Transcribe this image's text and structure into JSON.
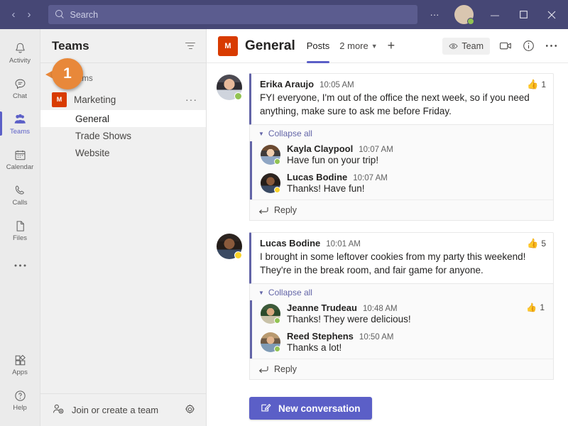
{
  "titlebar": {
    "back_label": "‹",
    "forward_label": "›",
    "search_placeholder": "Search",
    "more_label": "···",
    "minimize_label": "—",
    "maximize_label": "▫",
    "close_label": "✕",
    "user_presence": "available"
  },
  "rail": {
    "items": [
      {
        "label": "Activity",
        "icon": "bell-icon",
        "active": false
      },
      {
        "label": "Chat",
        "icon": "chat-icon",
        "active": false
      },
      {
        "label": "Teams",
        "icon": "teams-icon",
        "active": true
      },
      {
        "label": "Calendar",
        "icon": "calendar-icon",
        "active": false
      },
      {
        "label": "Calls",
        "icon": "phone-icon",
        "active": false
      },
      {
        "label": "Files",
        "icon": "file-icon",
        "active": false
      },
      {
        "label": "",
        "icon": "ellipsis-icon",
        "active": false
      }
    ],
    "bottom_items": [
      {
        "label": "Apps",
        "icon": "apps-icon"
      },
      {
        "label": "Help",
        "icon": "help-icon"
      }
    ]
  },
  "callout": {
    "number": "1",
    "color": "#e8883a"
  },
  "teams_panel": {
    "title": "Teams",
    "filter_icon": "filter-icon",
    "section_label": "Your teams",
    "team": {
      "name": "Marketing",
      "initial": "M",
      "color": "#d83b01",
      "more_label": "···"
    },
    "channels": [
      {
        "name": "General",
        "selected": true
      },
      {
        "name": "Trade Shows",
        "selected": false
      },
      {
        "name": "Website",
        "selected": false
      }
    ],
    "footer": {
      "label": "Join or create a team",
      "icon": "add-people-icon",
      "settings_icon": "gear-icon"
    }
  },
  "channel_header": {
    "team_initial": "M",
    "title": "General",
    "tabs": [
      {
        "label": "Posts",
        "active": true
      },
      {
        "label": "2 more",
        "active": false,
        "has_chevron": true
      }
    ],
    "add_tab_label": "+",
    "team_button_label": "Team",
    "meet_icon": "video-camera-icon",
    "info_icon": "info-icon",
    "more_icon": "more-options-icon"
  },
  "conversation": {
    "threads": [
      {
        "author": "Erika Araujo",
        "time": "10:05 AM",
        "text": "FYI everyone, I'm out of the office the next week, so if you need anything, make sure to ask me before Friday.",
        "presence": "available",
        "avatar_class": "f1",
        "reaction": {
          "emoji": "👍",
          "count": "1"
        },
        "collapse_label": "Collapse all",
        "reply_label": "Reply",
        "replies": [
          {
            "author": "Kayla Claypool",
            "time": "10:07 AM",
            "text": "Have fun on your trip!",
            "presence": "available",
            "avatar_class": "f2",
            "reaction": null
          },
          {
            "author": "Lucas Bodine",
            "time": "10:07 AM",
            "text": "Thanks! Have fun!",
            "presence": "away",
            "avatar_class": "f3",
            "reaction": null
          }
        ]
      },
      {
        "author": "Lucas Bodine",
        "time": "10:01 AM",
        "text": "I brought in some leftover cookies from my party this weekend! They're in the break room, and fair game for anyone.",
        "presence": "away",
        "avatar_class": "f3",
        "reaction": {
          "emoji": "👍",
          "count": "5"
        },
        "collapse_label": "Collapse all",
        "reply_label": "Reply",
        "replies": [
          {
            "author": "Jeanne Trudeau",
            "time": "10:48 AM",
            "text": "Thanks! They were delicious!",
            "presence": "available",
            "avatar_class": "f4",
            "reaction": {
              "emoji": "👍",
              "count": "1"
            }
          },
          {
            "author": "Reed Stephens",
            "time": "10:50 AM",
            "text": "Thanks a lot!",
            "presence": "available",
            "avatar_class": "f5",
            "reaction": null
          }
        ]
      }
    ],
    "new_conversation_label": "New conversation",
    "new_conversation_icon": "compose-icon"
  }
}
